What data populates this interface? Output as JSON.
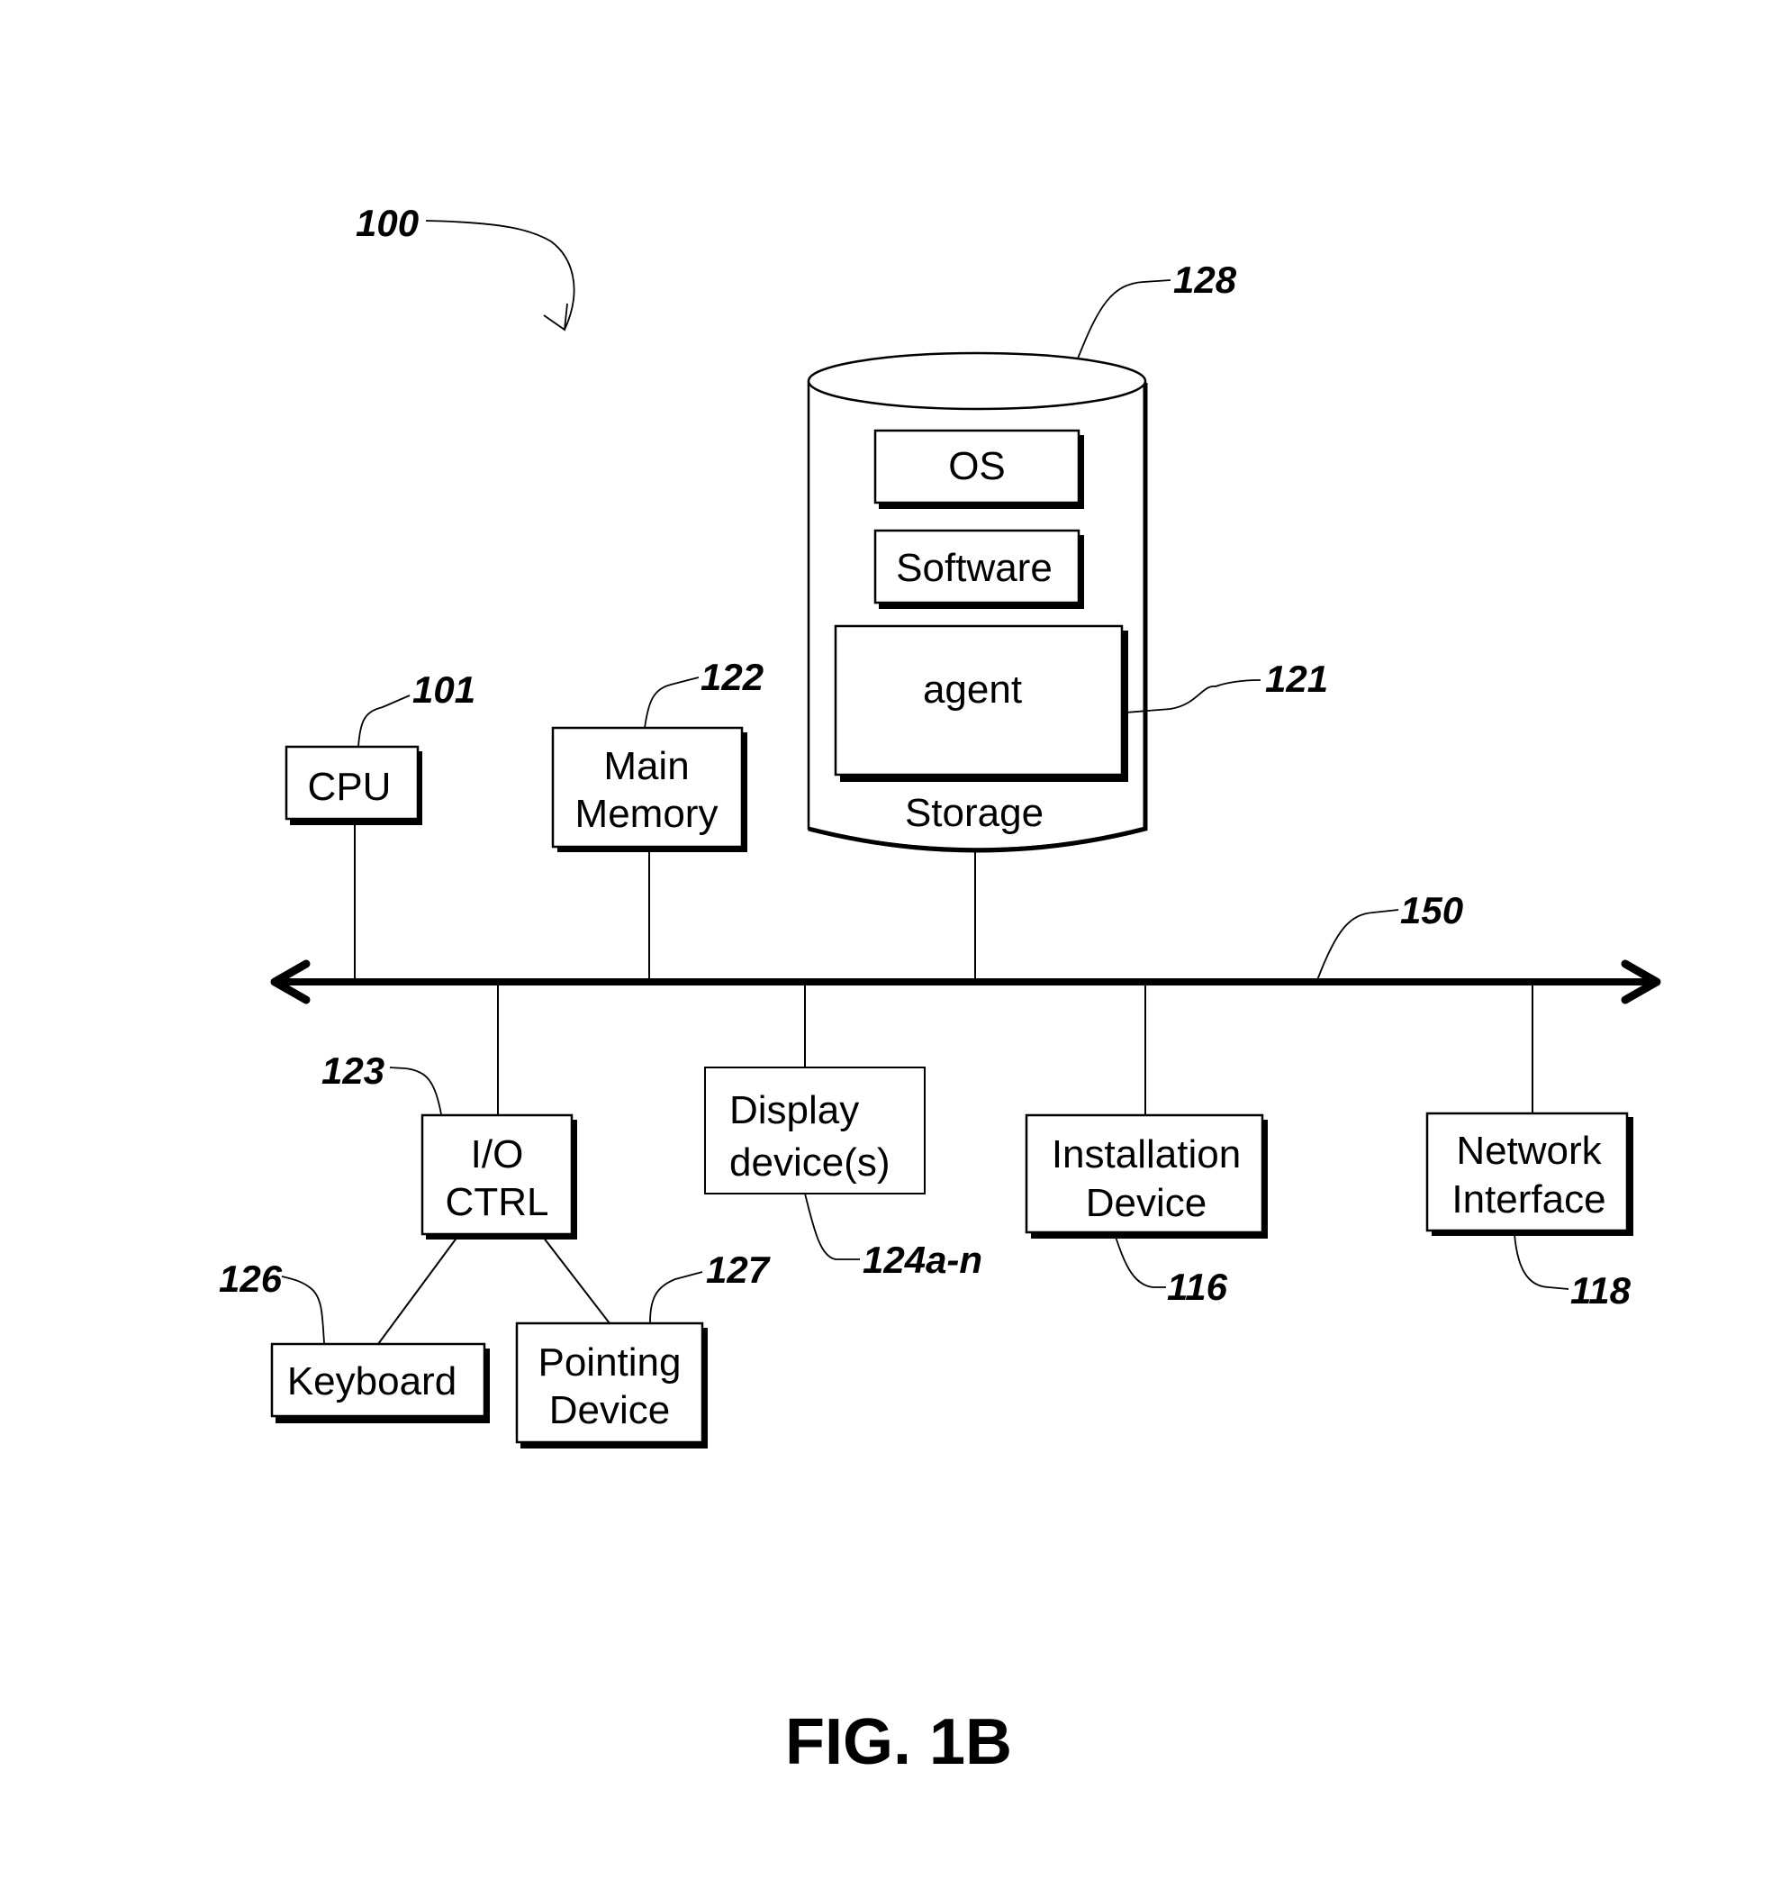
{
  "figure": {
    "title": "FIG. 1B",
    "system_ref": "100"
  },
  "bus": {
    "ref": "150"
  },
  "storage": {
    "label": "Storage",
    "ref": "128",
    "contents": {
      "os": "OS",
      "software": "Software",
      "agent": "agent",
      "agent_ref": "121"
    }
  },
  "components": {
    "cpu": {
      "lines": [
        "CPU"
      ],
      "ref": "101"
    },
    "main_memory": {
      "lines": [
        "Main",
        "Memory"
      ],
      "ref": "122"
    },
    "io_ctrl": {
      "lines": [
        "I/O",
        "CTRL"
      ],
      "ref": "123"
    },
    "display": {
      "lines": [
        "Display",
        "device(s)"
      ],
      "ref": "124a-n"
    },
    "installation": {
      "lines": [
        "Installation",
        "Device"
      ],
      "ref": "116"
    },
    "network": {
      "lines": [
        "Network",
        "Interface"
      ],
      "ref": "118"
    },
    "keyboard": {
      "lines": [
        "Keyboard"
      ],
      "ref": "126"
    },
    "pointing": {
      "lines": [
        "Pointing",
        "Device"
      ],
      "ref": "127"
    }
  }
}
